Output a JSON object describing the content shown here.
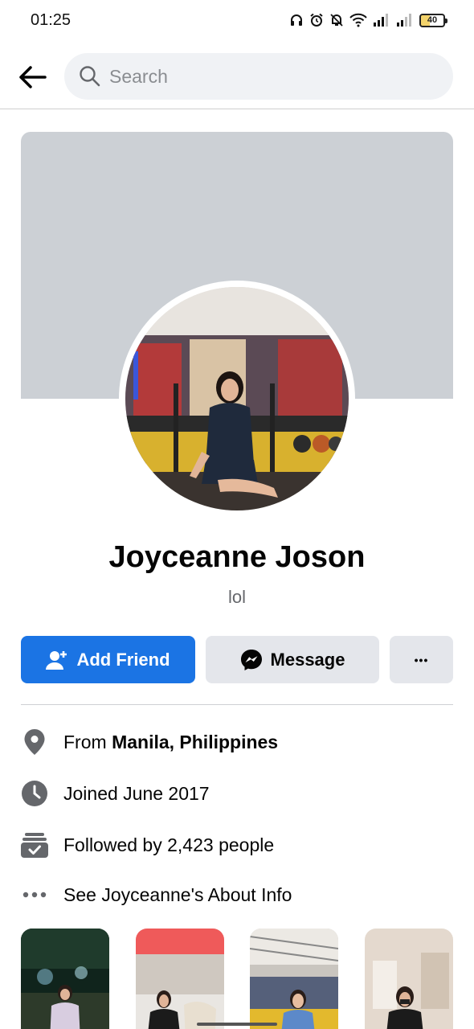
{
  "status_bar": {
    "time": "01:25",
    "battery": "40",
    "icons": [
      "headphones-icon",
      "alarm-icon",
      "bell-muted-icon",
      "wifi-icon",
      "signal-icon",
      "signal-icon-2",
      "battery-icon"
    ]
  },
  "header": {
    "back_icon": "arrow-left-icon",
    "search_placeholder": "Search",
    "search_value": ""
  },
  "profile": {
    "name": "Joyceanne Joson",
    "bio": "lol"
  },
  "actions": {
    "add_friend_label": "Add Friend",
    "message_label": "Message",
    "more_label": "•••"
  },
  "details": {
    "from_prefix": "From ",
    "from_value": "Manila, Philippines",
    "joined": "Joined June 2017",
    "followed": "Followed by 2,423 people",
    "about": "See Joyceanne's About Info"
  },
  "colors": {
    "accent": "#1b74e4",
    "secondary_button": "#e4e6eb",
    "cover": "#ccd0d5",
    "muted_text": "#65676b",
    "icon_gray": "#65676b"
  }
}
